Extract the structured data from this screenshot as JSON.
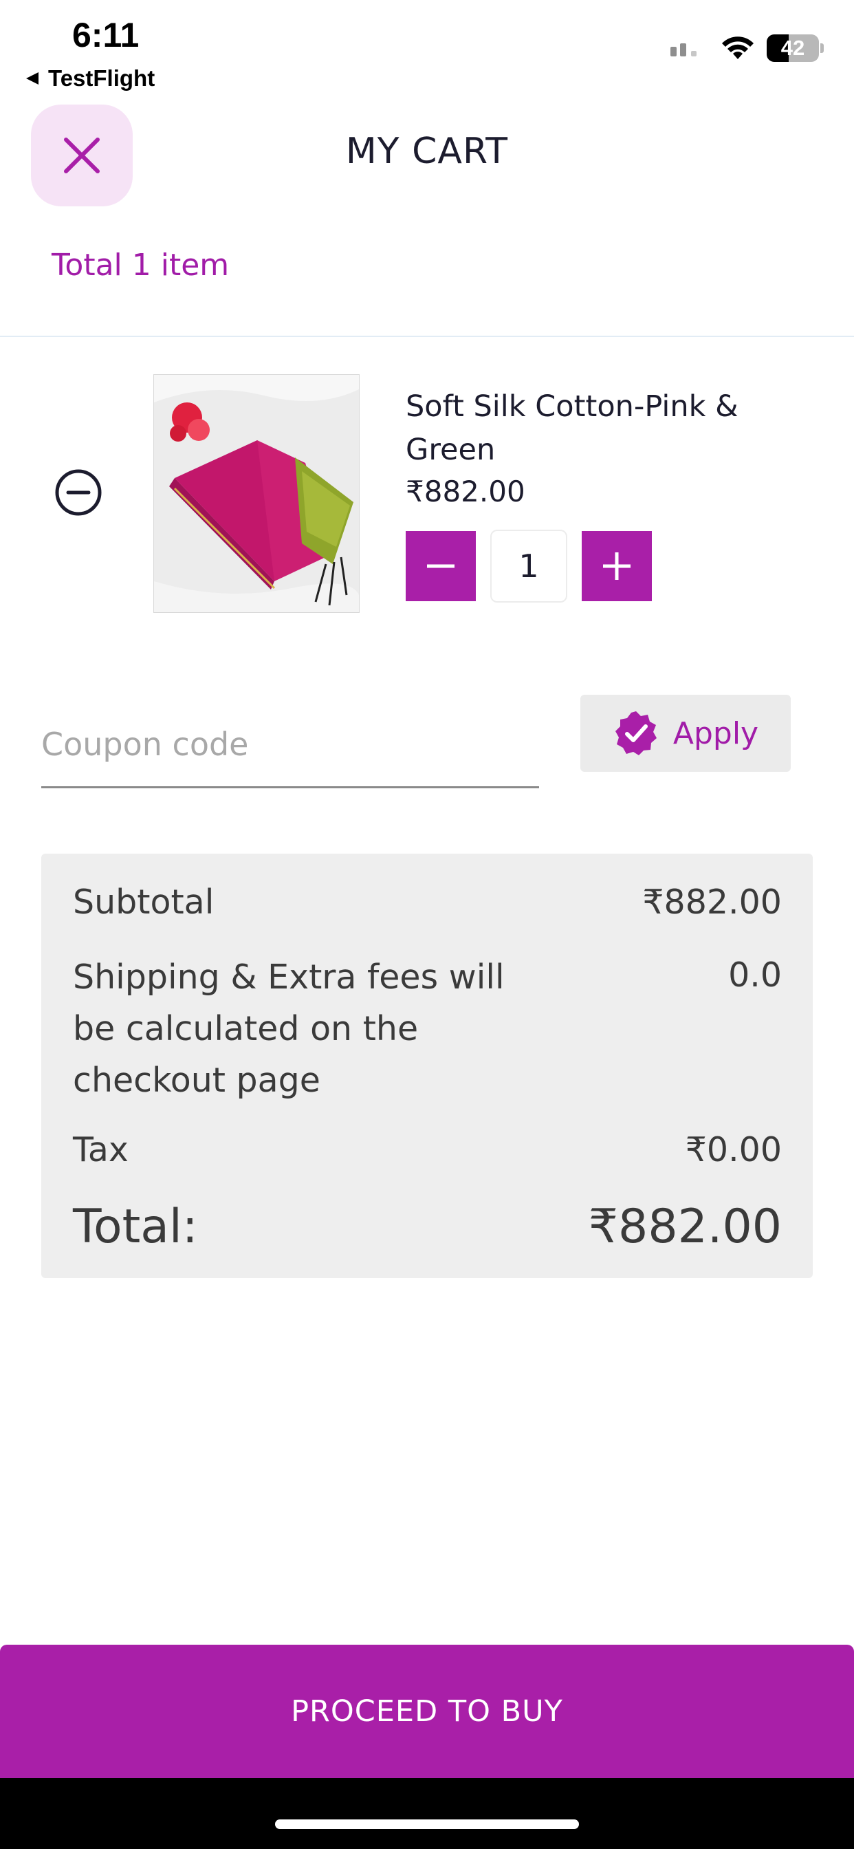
{
  "status_bar": {
    "time": "6:11",
    "back_app": "TestFlight",
    "battery": "42",
    "battery_level": 0.42
  },
  "header": {
    "title": "MY CART",
    "item_count": "Total 1 item"
  },
  "cart_item": {
    "name": "Soft Silk Cotton-Pink & Green",
    "price": "₹882.00",
    "quantity": "1"
  },
  "coupon": {
    "placeholder": "Coupon code",
    "value": "",
    "apply_label": "Apply"
  },
  "summary": {
    "subtotal_label": "Subtotal",
    "subtotal_value": "₹882.00",
    "shipping_label": "Shipping & Extra fees will be calculated on the checkout page",
    "shipping_value": "0.0",
    "tax_label": "Tax",
    "tax_value": "₹0.00",
    "total_label": "Total:",
    "total_value": "₹882.00"
  },
  "proceed": {
    "label": "PROCEED TO BUY"
  },
  "colors": {
    "accent": "#a91fa8",
    "accent_text": "#a11ca8",
    "close_bg": "#f6e3f6",
    "summary_bg": "#eeeeee"
  }
}
